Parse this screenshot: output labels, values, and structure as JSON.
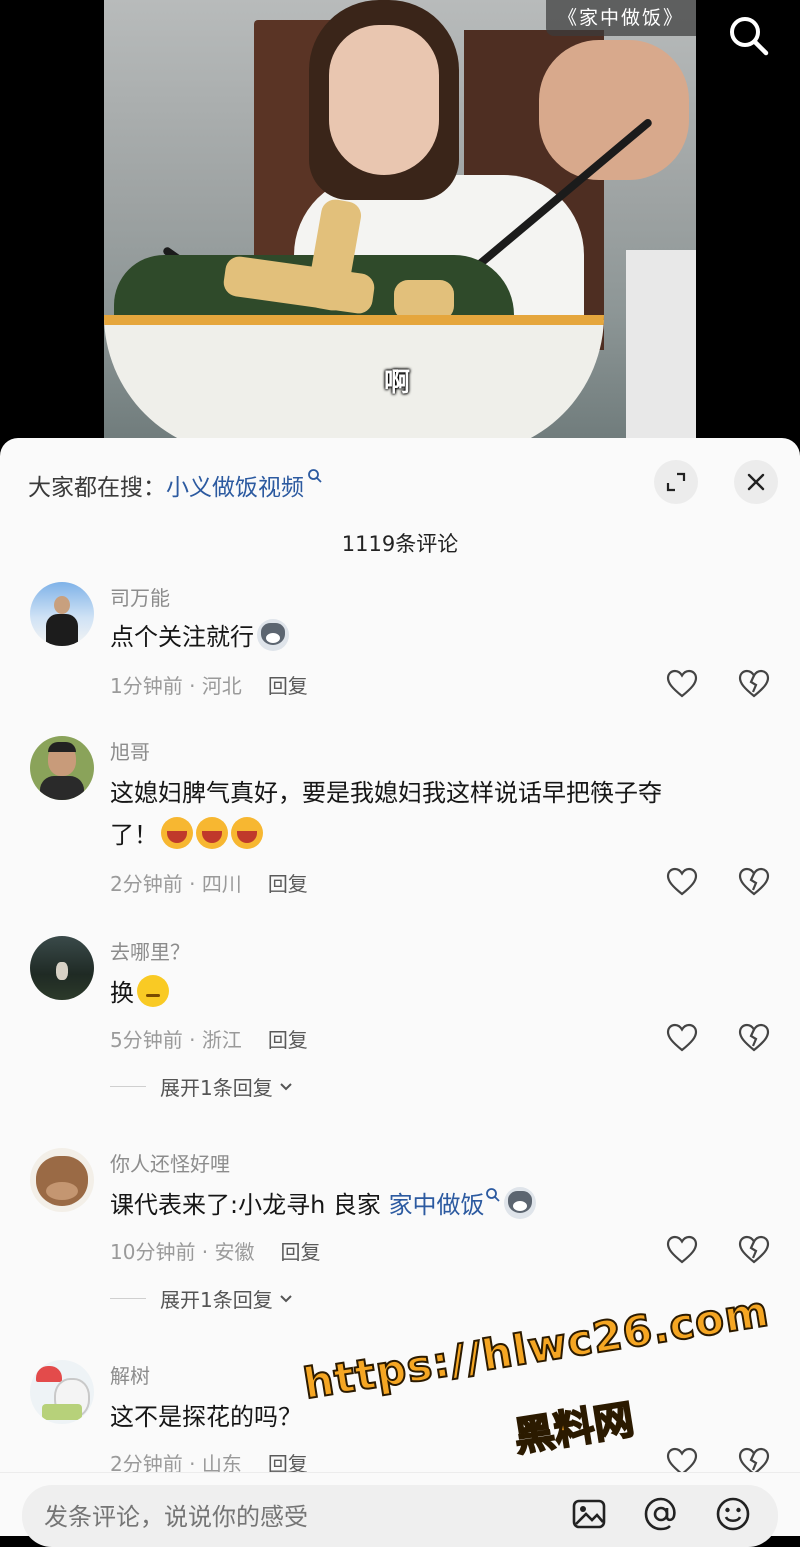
{
  "video": {
    "top_tag": "《家中做饭》",
    "subtitle": "啊"
  },
  "panel": {
    "hot_search_prefix": "大家都在搜：",
    "hot_search_term": "小义做饭视频",
    "comment_count": "1119条评论"
  },
  "comments": [
    {
      "username": "司万能",
      "text": "点个关注就行",
      "emojis": [
        "fox-emoji"
      ],
      "time": "1分钟前",
      "location": "河北",
      "reply_label": "回复"
    },
    {
      "username": "旭哥",
      "text_line1": "这媳妇脾气真好，要是我媳妇我这样说话早把筷子夺",
      "text_line2": "了！",
      "emojis": [
        "laugh-emoji",
        "laugh-emoji",
        "laugh-emoji"
      ],
      "time": "2分钟前",
      "location": "四川",
      "reply_label": "回复"
    },
    {
      "username": "去哪里？",
      "text": "换",
      "emojis": [
        "thinking-emoji"
      ],
      "time": "5分钟前",
      "location": "浙江",
      "reply_label": "回复",
      "expand_label": "展开1条回复"
    },
    {
      "username": "你人还怪好哩",
      "text": "课代表来了:小龙寻h 良家 ",
      "link_text": "家中做饭",
      "emojis": [
        "fox-emoji"
      ],
      "time": "10分钟前",
      "location": "安徽",
      "reply_label": "回复",
      "expand_label": "展开1条回复"
    },
    {
      "username": "解树",
      "text": "这不是探花的吗？",
      "time": "2分钟前",
      "location": "山东",
      "reply_label": "回复"
    }
  ],
  "input": {
    "placeholder": "发条评论，说说你的感受"
  },
  "watermark": {
    "url": "https://hlwc26.com",
    "name": "黑料网"
  },
  "meta_separator": " · "
}
